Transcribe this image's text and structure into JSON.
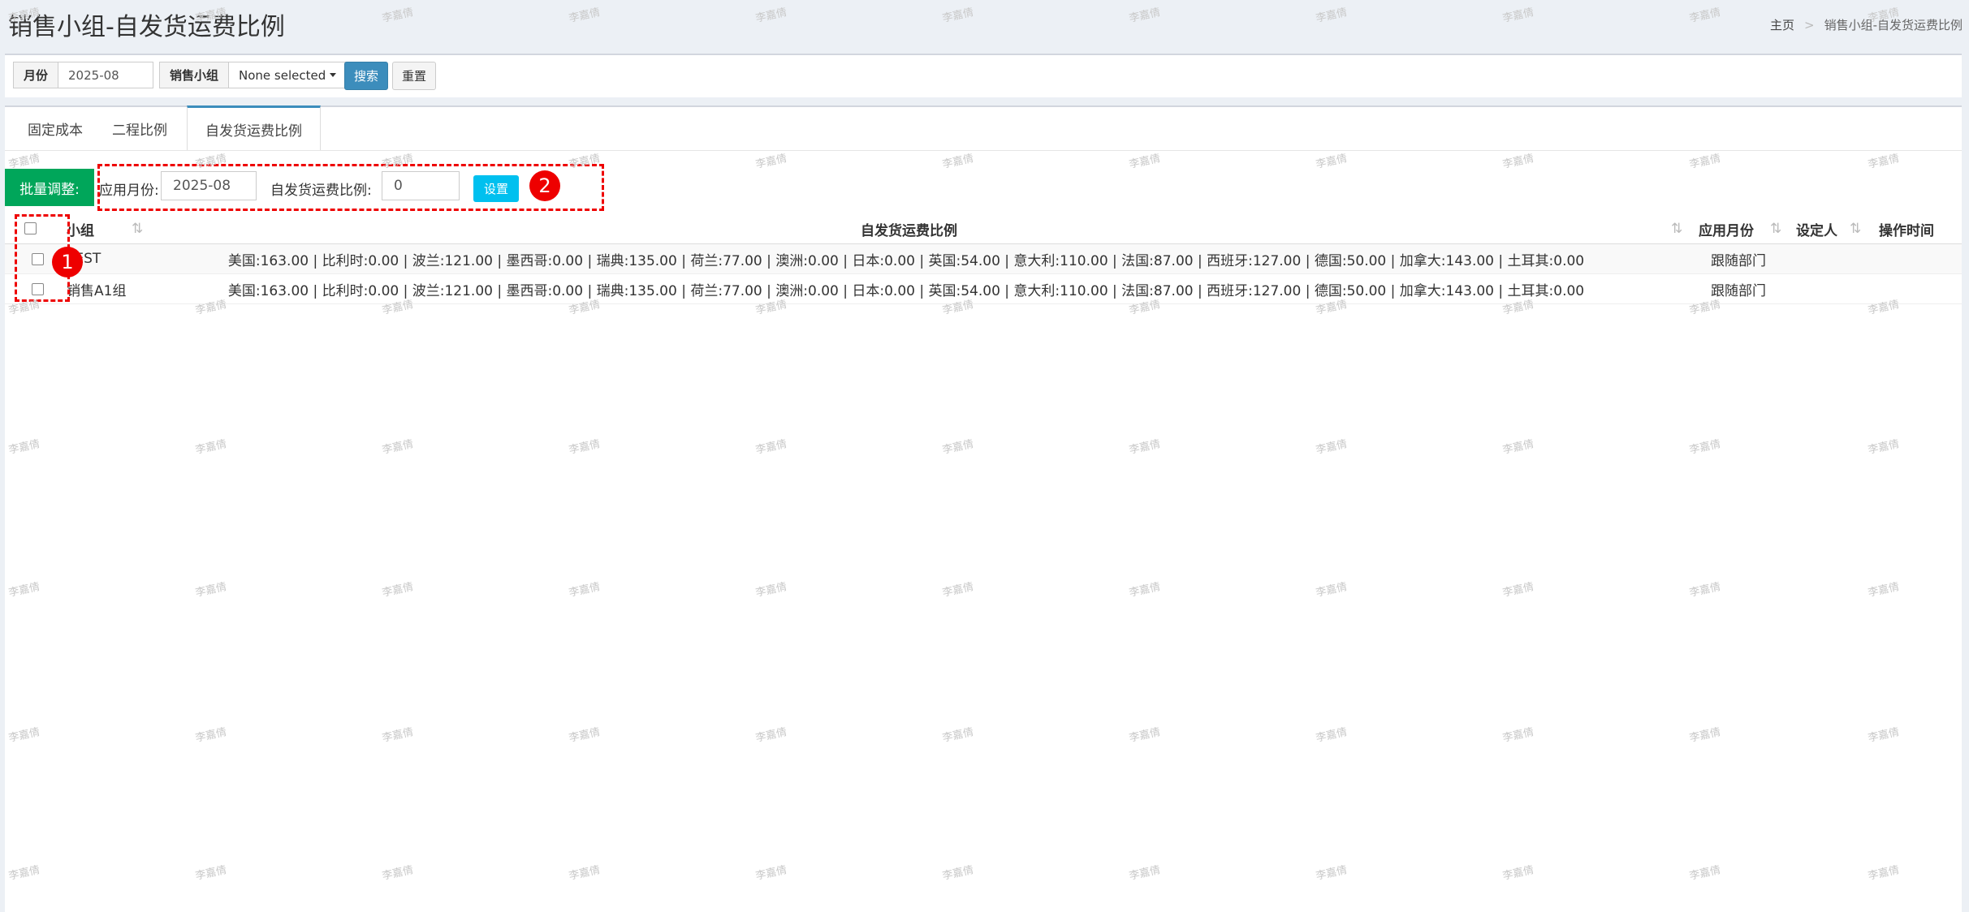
{
  "page": {
    "title": "销售小组-自发货运费比例",
    "breadcrumb": {
      "home": "主页",
      "sep": ">",
      "current": "销售小组-自发货运费比例"
    }
  },
  "filters": {
    "month_label": "月份",
    "month_value": "2025-08",
    "group_label": "销售小组",
    "group_value": "None selected",
    "search_label": "搜索",
    "reset_label": "重置"
  },
  "tabs": [
    {
      "label": "固定成本"
    },
    {
      "label": "二程比例"
    },
    {
      "label": "自发货运费比例"
    }
  ],
  "batch": {
    "label": "批量调整:",
    "month_label": "应用月份:",
    "month_value": "2025-08",
    "ratio_label": "自发货运费比例:",
    "ratio_value": "0",
    "set_label": "设置"
  },
  "annotations": {
    "badge1": "1",
    "badge2": "2"
  },
  "table": {
    "columns": {
      "group": "小组",
      "ratio": "自发货运费比例",
      "month": "应用月份",
      "setter": "设定人",
      "time": "操作时间"
    },
    "rows": [
      {
        "group": "TEST",
        "ratio": "美国:163.00 | 比利时:0.00 | 波兰:121.00 | 墨西哥:0.00 | 瑞典:135.00 | 荷兰:77.00 | 澳洲:0.00 | 日本:0.00 | 英国:54.00 | 意大利:110.00 | 法国:87.00 | 西班牙:127.00 | 德国:50.00 | 加拿大:143.00 | 土耳其:0.00",
        "month": "跟随部门",
        "setter": "",
        "time": ""
      },
      {
        "group": "销售A1组",
        "ratio": "美国:163.00 | 比利时:0.00 | 波兰:121.00 | 墨西哥:0.00 | 瑞典:135.00 | 荷兰:77.00 | 澳洲:0.00 | 日本:0.00 | 英国:54.00 | 意大利:110.00 | 法国:87.00 | 西班牙:127.00 | 德国:50.00 | 加拿大:143.00 | 土耳其:0.00",
        "month": "跟随部门",
        "setter": "",
        "time": ""
      }
    ]
  },
  "watermark": "李嘉倩"
}
